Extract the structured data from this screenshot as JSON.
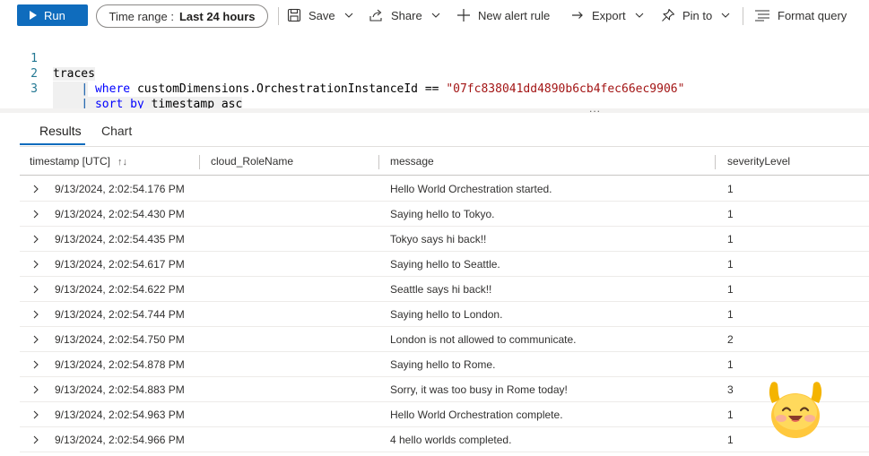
{
  "toolbar": {
    "run_label": "Run",
    "time_range_label": "Time range :",
    "time_range_value": "Last 24 hours",
    "save_label": "Save",
    "share_label": "Share",
    "new_alert_label": "New alert rule",
    "export_label": "Export",
    "pin_label": "Pin to",
    "format_label": "Format query"
  },
  "editor": {
    "lines": [
      {
        "number": "1",
        "text": "traces"
      },
      {
        "number": "2",
        "pipe": "|",
        "keyword": "where",
        "field": "customDimensions.OrchestrationInstanceId",
        "operator": "==",
        "string": "\"07fc838041dd4890b6cb4fec66ec9906\""
      },
      {
        "number": "3",
        "pipe": "|",
        "keyword": "sort by",
        "rest": "timestamp asc"
      }
    ],
    "ellipsis": "..."
  },
  "tabs": [
    {
      "label": "Results",
      "active": true
    },
    {
      "label": "Chart",
      "active": false
    }
  ],
  "table": {
    "columns": [
      "timestamp [UTC]",
      "cloud_RoleName",
      "message",
      "severityLevel"
    ],
    "sort_indicator": "↑↓",
    "rows": [
      {
        "timestamp": "9/13/2024, 2:02:54.176 PM",
        "role": "",
        "message": "Hello World Orchestration started.",
        "severity": "1"
      },
      {
        "timestamp": "9/13/2024, 2:02:54.430 PM",
        "role": "",
        "message": "Saying hello to Tokyo.",
        "severity": "1"
      },
      {
        "timestamp": "9/13/2024, 2:02:54.435 PM",
        "role": "",
        "message": "Tokyo says hi back!!",
        "severity": "1"
      },
      {
        "timestamp": "9/13/2024, 2:02:54.617 PM",
        "role": "",
        "message": "Saying hello to Seattle.",
        "severity": "1"
      },
      {
        "timestamp": "9/13/2024, 2:02:54.622 PM",
        "role": "",
        "message": "Seattle says hi back!!",
        "severity": "1"
      },
      {
        "timestamp": "9/13/2024, 2:02:54.744 PM",
        "role": "",
        "message": "Saying hello to London.",
        "severity": "1"
      },
      {
        "timestamp": "9/13/2024, 2:02:54.750 PM",
        "role": "",
        "message": "London is not allowed to communicate.",
        "severity": "2"
      },
      {
        "timestamp": "9/13/2024, 2:02:54.878 PM",
        "role": "",
        "message": "Saying hello to Rome.",
        "severity": "1"
      },
      {
        "timestamp": "9/13/2024, 2:02:54.883 PM",
        "role": "",
        "message": "Sorry, it was too busy in Rome today!",
        "severity": "3"
      },
      {
        "timestamp": "9/13/2024, 2:02:54.963 PM",
        "role": "",
        "message": "Hello World Orchestration complete.",
        "severity": "1"
      },
      {
        "timestamp": "9/13/2024, 2:02:54.966 PM",
        "role": "",
        "message": "4 hello worlds completed.",
        "severity": "1"
      }
    ]
  },
  "colors": {
    "accent": "#0f6cbd",
    "keyword": "#0000ff",
    "string": "#a31515",
    "line_number": "#237893"
  },
  "icons": {
    "run": "play-icon",
    "save": "save-icon",
    "share": "share-icon",
    "new_alert": "plus-icon",
    "export": "export-icon",
    "pin": "pin-icon",
    "format": "format-query-icon",
    "row_expand": "chevron-right-icon",
    "decoration": "celebrating-emoji-icon"
  }
}
